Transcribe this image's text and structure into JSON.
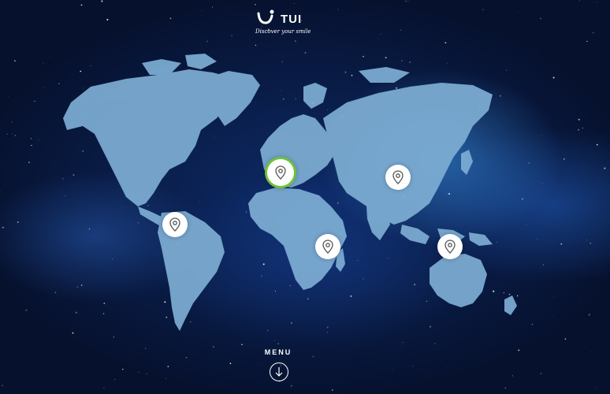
{
  "brand": {
    "name": "TUI",
    "tagline": "Discover your smile",
    "logo_icon": "tui-smile-icon",
    "color": "#ffffff"
  },
  "map": {
    "land_color": "#7eaed4",
    "pins": [
      {
        "name": "pin-europe",
        "icon": "map-pin-icon",
        "active": true
      },
      {
        "name": "pin-asia",
        "icon": "map-pin-icon",
        "active": false
      },
      {
        "name": "pin-caribbean",
        "icon": "map-pin-icon",
        "active": false
      },
      {
        "name": "pin-africa",
        "icon": "map-pin-icon",
        "active": false
      },
      {
        "name": "pin-southeast-asia",
        "icon": "map-pin-icon",
        "active": false
      }
    ],
    "active_color": "#6fc23b"
  },
  "menu": {
    "label": "MENU",
    "icon": "arrow-down-icon"
  }
}
